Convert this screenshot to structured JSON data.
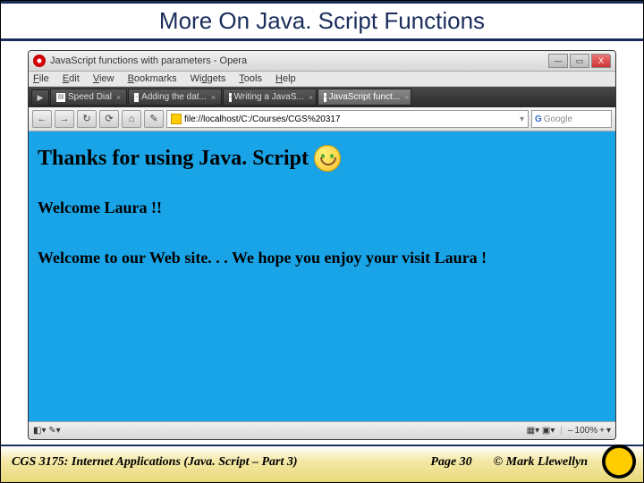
{
  "slide": {
    "title": "More On Java. Script Functions"
  },
  "browser": {
    "window_title": "JavaScript functions with parameters - Opera",
    "window_buttons": {
      "min": "—",
      "max": "▭",
      "close": "X"
    },
    "menu": [
      "File",
      "Edit",
      "View",
      "Bookmarks",
      "Widgets",
      "Tools",
      "Help"
    ],
    "menu_raw": {
      "f": "F",
      "e": "E",
      "v": "V",
      "b": "B",
      "w": "W",
      "t": "T",
      "h": "H"
    },
    "tabs": [
      {
        "label": "Speed Dial",
        "active": false
      },
      {
        "label": "Adding the dat...",
        "active": false
      },
      {
        "label": "Writing a JavaS...",
        "active": false
      },
      {
        "label": "JavaScript funct...",
        "active": true
      }
    ],
    "nav": {
      "back": "←",
      "fwd": "→",
      "reload": "↻",
      "stop": "⟳",
      "home": "⌂",
      "wand": "✎"
    },
    "address": "file://localhost/C:/Courses/CGS%20317",
    "search_engine": "G",
    "search_placeholder": "Google",
    "content": {
      "heading": "Thanks for using Java. Script",
      "line1": "Welcome Laura !!",
      "line2": "Welcome to our Web site. . . We hope you enjoy your visit Laura !"
    },
    "status": {
      "left_icons": "◧▾ ✎▾",
      "right_icons": "▦▾ ▣▾",
      "zoom_label": "100%",
      "zoom_dn": "–",
      "zoom_up": "+",
      "zoom_dd": "▾"
    }
  },
  "footer": {
    "course": "CGS 3175: Internet Applications (Java. Script – Part 3)",
    "page": "Page 30",
    "copyright": "© Mark Llewellyn"
  }
}
